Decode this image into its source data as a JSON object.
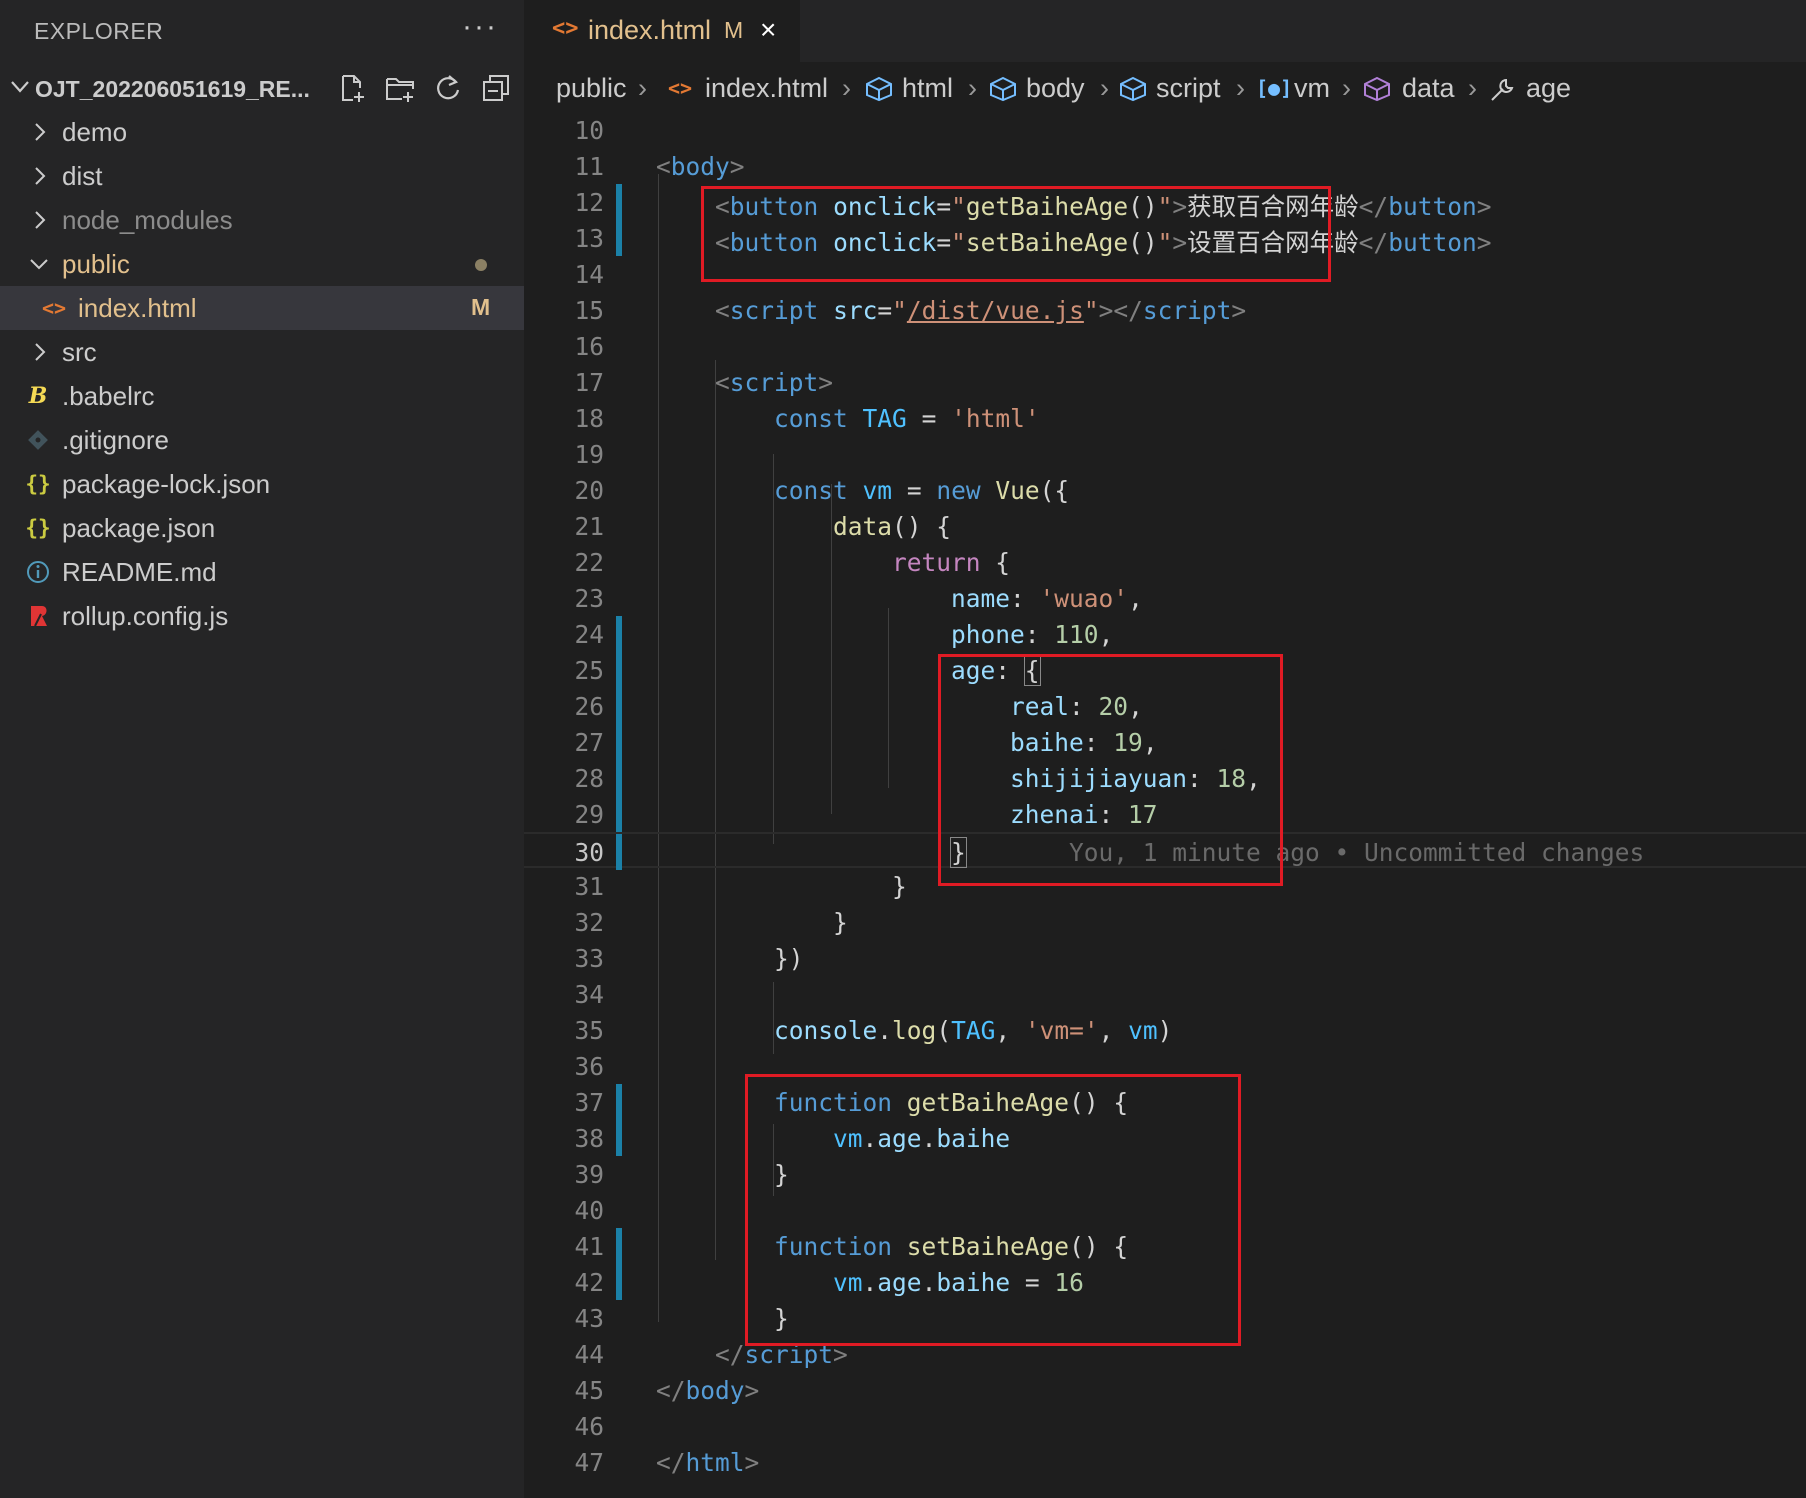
{
  "sidebar": {
    "header": "EXPLORER",
    "more": "···",
    "root": "OJT_202206051619_RE...",
    "items": [
      {
        "label": "demo",
        "kind": "folder",
        "expanded": false
      },
      {
        "label": "dist",
        "kind": "folder",
        "expanded": false
      },
      {
        "label": "node_modules",
        "kind": "folder",
        "expanded": false
      },
      {
        "label": "public",
        "kind": "folder",
        "expanded": true
      },
      {
        "label": "index.html",
        "kind": "file",
        "badge": "M"
      },
      {
        "label": "src",
        "kind": "folder",
        "expanded": false
      },
      {
        "label": ".babelrc",
        "kind": "file"
      },
      {
        "label": ".gitignore",
        "kind": "file"
      },
      {
        "label": "package-lock.json",
        "kind": "file"
      },
      {
        "label": "package.json",
        "kind": "file"
      },
      {
        "label": "README.md",
        "kind": "file"
      },
      {
        "label": "rollup.config.js",
        "kind": "file"
      }
    ]
  },
  "tab": {
    "label": "index.html",
    "badge": "M",
    "close": "×"
  },
  "breadcrumb": [
    "public",
    "index.html",
    "html",
    "body",
    "script",
    "vm",
    "data",
    "age"
  ],
  "code": {
    "line_numbers": [
      "10",
      "11",
      "12",
      "13",
      "14",
      "15",
      "16",
      "17",
      "18",
      "19",
      "20",
      "21",
      "22",
      "23",
      "24",
      "25",
      "26",
      "27",
      "28",
      "29",
      "30",
      "31",
      "32",
      "33",
      "34",
      "35",
      "36",
      "37",
      "38",
      "39",
      "40",
      "41",
      "42",
      "43",
      "44",
      "45",
      "46",
      "47"
    ],
    "current_line": "30",
    "blame": "You, 1 minute ago • Uncommitted changes",
    "chinese_get": "获取百合网年龄",
    "chinese_set": "设置百合网年龄"
  },
  "colors": {
    "annotation_box": "#e01b24",
    "git_modified": "#1b81a8",
    "modified_badge": "#e2c08d"
  }
}
